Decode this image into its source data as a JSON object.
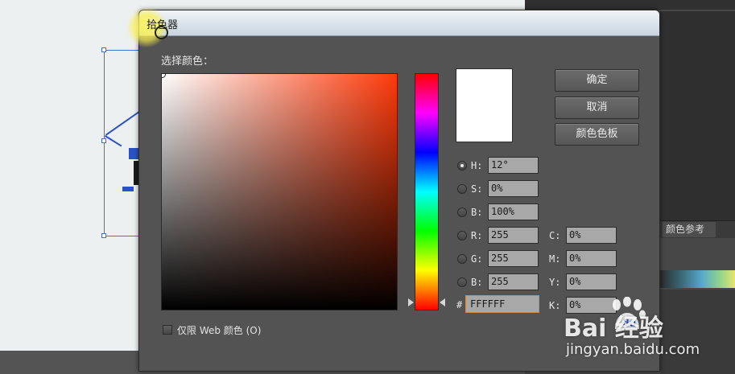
{
  "dialog": {
    "title": "拾色器",
    "section_label": "选择颜色：",
    "preview_color": "#FFFFFF",
    "field_hue_color": "#ff3a0a",
    "buttons": {
      "ok": "确定",
      "cancel": "取消",
      "swatches": "颜色色板"
    },
    "hsb": [
      {
        "label": "H:",
        "value": "12°",
        "checked": true
      },
      {
        "label": "S:",
        "value": "0%",
        "checked": false
      },
      {
        "label": "B:",
        "value": "100%",
        "checked": false
      }
    ],
    "rgb": [
      {
        "label": "R:",
        "value": "255"
      },
      {
        "label": "G:",
        "value": "255"
      },
      {
        "label": "B:",
        "value": "255"
      }
    ],
    "cmyk": [
      {
        "label": "C:",
        "value": "0%"
      },
      {
        "label": "M:",
        "value": "0%"
      },
      {
        "label": "Y:",
        "value": "0%"
      },
      {
        "label": "K:",
        "value": "0%"
      }
    ],
    "hex_label": "#",
    "hex_value": "FFFFFF",
    "web_only_label": "仅限 Web 颜色 (O)"
  },
  "background": {
    "panel_tab": "颜色参考"
  },
  "watermark": {
    "brand": "Bai   经验",
    "url": "jingyan.baidu.com"
  }
}
